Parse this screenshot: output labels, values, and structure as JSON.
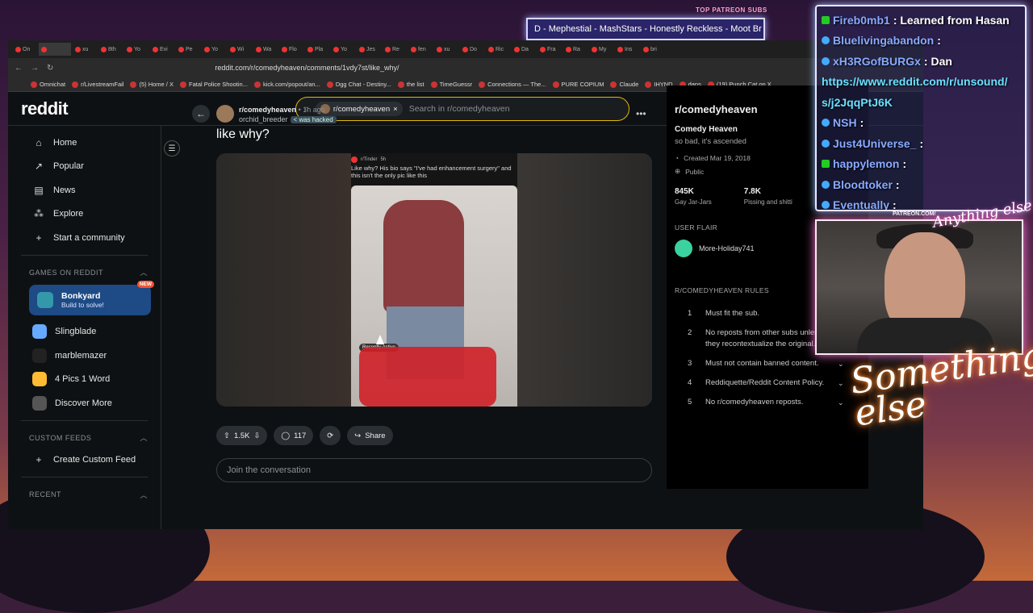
{
  "overlay": {
    "top_label": "TOP PATREON SUBS",
    "marquee": "D - Mephestial - MashStars - Honestly Reckless - Moot Br",
    "patreon_label": "PATREON.COM/",
    "neon_main": "Something else",
    "neon_small": "Anything else"
  },
  "browser": {
    "tabs": [
      "On",
      "",
      "xu",
      "8th",
      "Yo",
      "Evi",
      "Pe",
      "Yo",
      "Wi",
      "Wa",
      "Flo",
      "Pla",
      "Yo",
      "Jes",
      "Re",
      "fen",
      "xu",
      "Do",
      "Ric",
      "Da",
      "Fra",
      "Ra",
      "My",
      "Ins",
      "bri"
    ],
    "url": "reddit.com/r/comedyheaven/comments/1vdy7st/like_why/",
    "bookmarks": [
      "Omnichat",
      "r/LivestreamFail",
      "(5) Home / X",
      "Fatal Police Shootin...",
      "kick.com/popout/an...",
      "Dgg Chat - Destiny...",
      "the list",
      "TimeGuessr",
      "Connections — The...",
      "PURE COPIUM",
      "Claude",
      "IHYND",
      "dans",
      "(19) Punch Cat on X..."
    ]
  },
  "reddit": {
    "logo": "reddit",
    "search_chip": "r/comedyheaven",
    "search_placeholder": "Search in r/comedyheaven",
    "nav": [
      {
        "label": "Home",
        "icon": "home-icon",
        "glyph": "⌂"
      },
      {
        "label": "Popular",
        "icon": "popular-icon",
        "glyph": "↗"
      },
      {
        "label": "News",
        "icon": "news-icon",
        "glyph": "▤"
      },
      {
        "label": "Explore",
        "icon": "explore-icon",
        "glyph": "⁂"
      },
      {
        "label": "Start a community",
        "icon": "plus-icon",
        "glyph": "+"
      }
    ],
    "games_header": "GAMES ON REDDIT",
    "featured_game": {
      "title": "Bonkyard",
      "subtitle": "Build to solve!",
      "badge": "NEW"
    },
    "games": [
      "Slingblade",
      "marblemazer",
      "4 Pics 1 Word",
      "Discover More"
    ],
    "custom_header": "CUSTOM FEEDS",
    "create_feed": "Create Custom Feed",
    "recent_header": "RECENT"
  },
  "post": {
    "subreddit": "r/comedyheaven",
    "time": "• 1h ago",
    "user": "orchid_breeder",
    "flair": "< was hacked",
    "title": "like why?",
    "inner_sub": "r/Tinder",
    "inner_time": "5h",
    "inner_caption": "Like why? His bio says \"I've had enhancement surgery\" and this isn't the only pic like this",
    "recently_active": "Recently Active",
    "votes": "1.5K",
    "comments": "117",
    "share": "Share",
    "join": "Join the conversation"
  },
  "sidebar_right": {
    "title": "r/comedyheaven",
    "name": "Comedy Heaven",
    "desc": "so bad, it's ascended",
    "created": "Created Mar 19, 2018",
    "visibility": "Public",
    "stats": [
      {
        "n": "845K",
        "l": "Gay Jar-Jars"
      },
      {
        "n": "7.8K",
        "l": "Pissing and shitti"
      }
    ],
    "user_flair_header": "USER FLAIR",
    "user_flair": "More-Holiday741",
    "rules_header": "R/COMEDYHEAVEN RULES",
    "rules": [
      "Must fit the sub.",
      "No reposts from other subs unless they recontextualize the original.",
      "Must not contain banned content.",
      "Reddiquette/Reddit Content Policy.",
      "No r/comedyheaven reposts."
    ]
  },
  "chat": [
    {
      "name": "Fireb0mb1",
      "text": ": Learned from Hasan",
      "badge": "k"
    },
    {
      "name": "Bluelivingabandon",
      "text": ":",
      "badge": ""
    },
    {
      "name": "xH3RGofBURGx",
      "text": ": Dan",
      "badge": ""
    },
    {
      "name": "",
      "text": "https://www.reddit.com/r/unsound/",
      "badge": "link"
    },
    {
      "name": "",
      "text": "s/j2JqqPtJ6K",
      "badge": "link"
    },
    {
      "name": "NSH",
      "text": ":",
      "badge": ""
    },
    {
      "name": "Just4Universe_",
      "text": ":",
      "badge": ""
    },
    {
      "name": "happylemon",
      "text": ":",
      "badge": "k"
    },
    {
      "name": "Bloodtoker",
      "text": ":",
      "badge": ""
    },
    {
      "name": "Eventually",
      "text": ":",
      "badge": ""
    }
  ]
}
